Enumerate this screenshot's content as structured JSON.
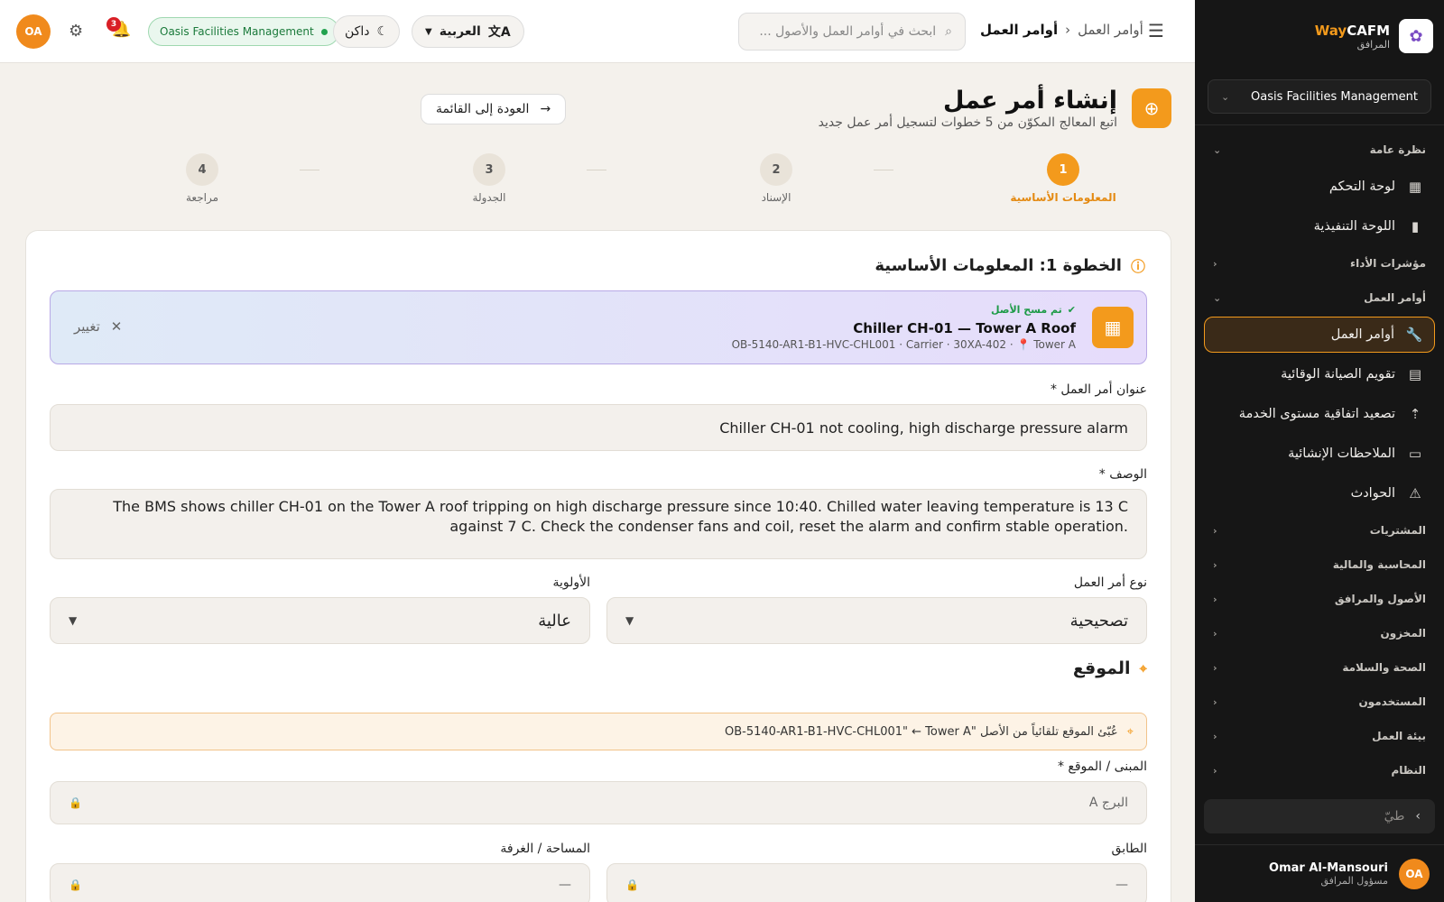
{
  "topbar": {
    "avatar_initials": "OA",
    "notifications_count": "3",
    "org_badge": "Oasis Facilities Management",
    "theme_label": "داكن",
    "language_label": "العربية",
    "search_placeholder": "ابحث في أوامر العمل والأصول ...",
    "breadcrumb": {
      "parent": "أوامر العمل",
      "current": "أوامر العمل"
    }
  },
  "sidebar": {
    "brand_name_a": "CAFM",
    "brand_name_b": "Way",
    "brand_sub": "المرافق",
    "org_select": "Oasis Facilities Management",
    "sections": {
      "overview": "نظرة عامة",
      "kpis": "مؤشرات الأداء",
      "work_orders": "أوامر العمل",
      "procurement": "المشتريات",
      "accounting": "المحاسبة والمالية",
      "assets": "الأصول والمرافق",
      "inventory": "المخزون",
      "hse": "الصحة والسلامة",
      "users": "المستخدمون",
      "environment": "بيئة العمل",
      "system": "النظام"
    },
    "items": {
      "dashboard": "لوحة التحكم",
      "executive": "اللوحة التنفيذية",
      "work_orders": "أوامر العمل",
      "pm_calendar": "تقويم الصيانة الوقائية",
      "sla_escalation": "تصعيد اتفاقية مستوى الخدمة",
      "construction_notes": "الملاحظات الإنشائية",
      "incidents": "الحوادث"
    },
    "collapse_label": "طيّ",
    "user": {
      "initials": "OA",
      "name": "Omar Al-Mansouri",
      "role": "مسؤول المرافق"
    }
  },
  "page": {
    "title": "إنشاء أمر عمل",
    "subtitle": "اتبع المعالج المكوّن من 5 خطوات لتسجيل أمر عمل جديد",
    "back_button": "العودة إلى القائمة",
    "steps": [
      {
        "num": "1",
        "label": "المعلومات الأساسية"
      },
      {
        "num": "2",
        "label": "الإسناد"
      },
      {
        "num": "3",
        "label": "الجدولة"
      },
      {
        "num": "4",
        "label": "مراجعة"
      }
    ],
    "step_heading": "الخطوة 1: المعلومات الأساسية"
  },
  "asset": {
    "scanned_label": "تم مسح الأصل",
    "name": "Chiller CH-01 — Tower A Roof",
    "meta": "OB-5140-AR1-B1-HVC-CHL001 · Carrier · 30XA-402 · 📍 Tower A",
    "change_label": "تغيير"
  },
  "form": {
    "title_label": "عنوان أمر العمل *",
    "title_value": "Chiller CH-01 not cooling, high discharge pressure alarm",
    "description_label": "الوصف *",
    "description_value": "The BMS shows chiller CH-01 on the Tower A roof tripping on high discharge pressure since 10:40. Chilled water leaving temperature is 13 C against 7 C. Check the condenser fans and coil, reset the alarm and confirm stable operation.",
    "type_label": "نوع أمر العمل",
    "type_value": "تصحيحية",
    "priority_label": "الأولوية",
    "priority_value": "عالية",
    "location_heading": "الموقع",
    "location_note": "عُبّئ الموقع تلقائياً من الأصل \"OB-5140-AR1-B1-HVC-CHL001\" ← Tower A",
    "building_label": "المبنى / الموقع *",
    "building_value": "البرج A",
    "floor_label": "الطابق",
    "floor_value": "—",
    "room_label": "المساحة / الغرفة",
    "room_value": "—"
  },
  "colors": {
    "accent": "#f39a1c",
    "sidebar_bg": "#161616",
    "success": "#22a24f",
    "danger": "#d91f26"
  }
}
